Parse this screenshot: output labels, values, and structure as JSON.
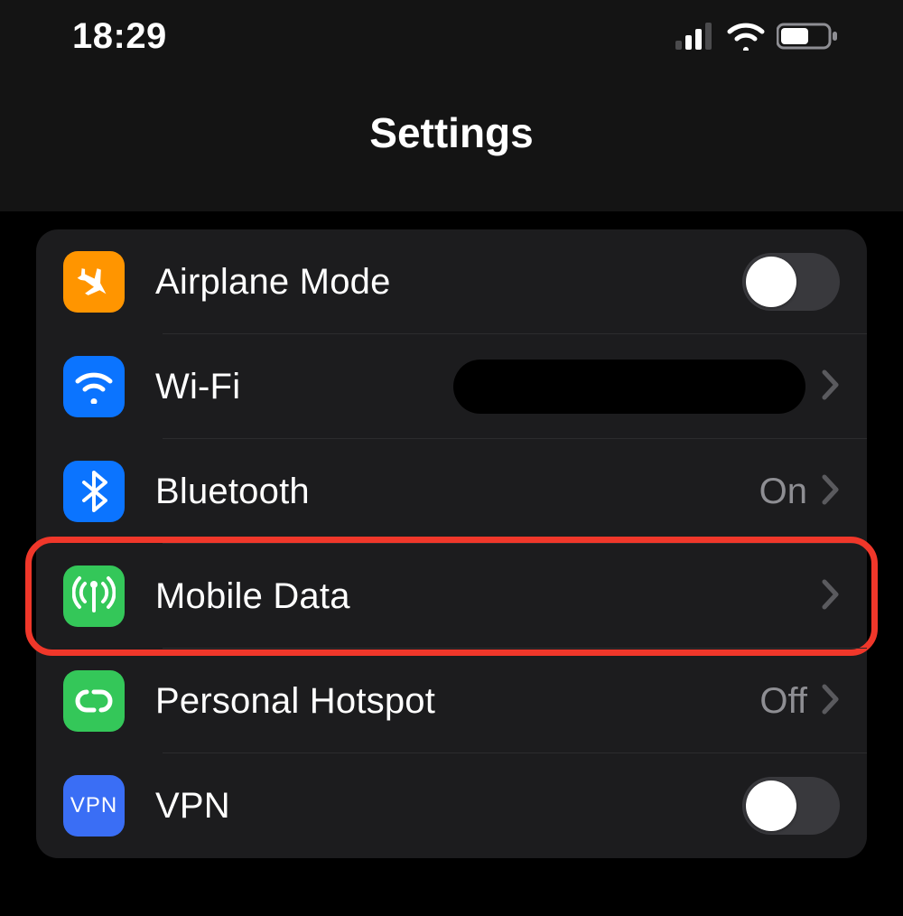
{
  "status": {
    "time": "18:29"
  },
  "header": {
    "title": "Settings"
  },
  "rows": {
    "airplane": {
      "label": "Airplane Mode",
      "toggle": "off"
    },
    "wifi": {
      "label": "Wi-Fi"
    },
    "bluetooth": {
      "label": "Bluetooth",
      "value": "On"
    },
    "mobiledata": {
      "label": "Mobile Data"
    },
    "hotspot": {
      "label": "Personal Hotspot",
      "value": "Off"
    },
    "vpn": {
      "label": "VPN",
      "icon_label": "VPN",
      "toggle": "off"
    }
  },
  "colors": {
    "orange": "#ff9500",
    "blue": "#0b74ff",
    "green": "#34c759",
    "highlight": "#f0372a"
  }
}
